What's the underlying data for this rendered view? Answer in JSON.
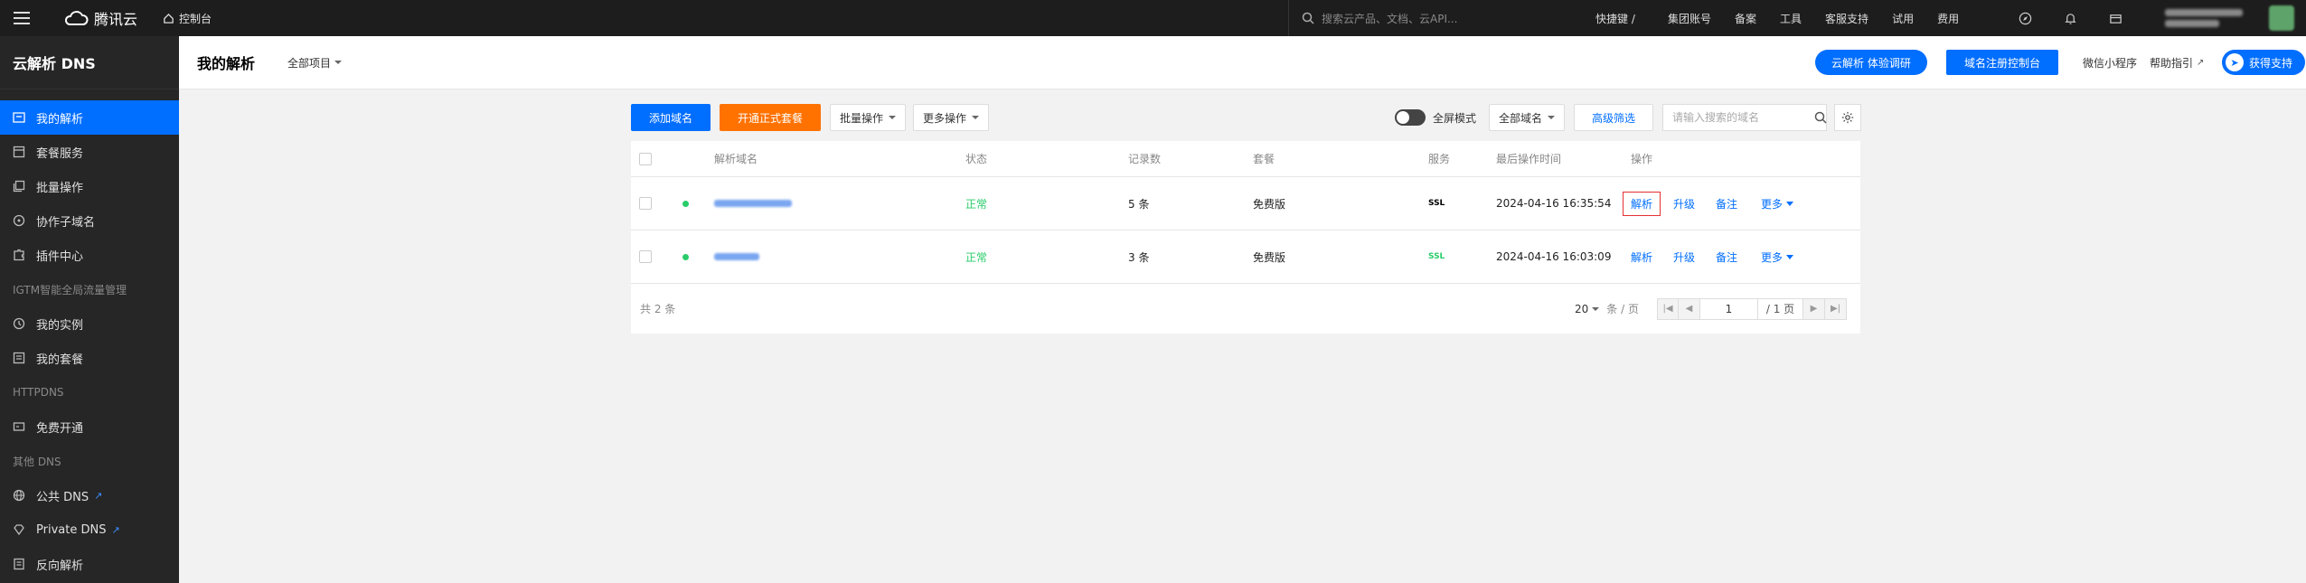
{
  "topbar": {
    "brand": "腾讯云",
    "console": "控制台",
    "search_placeholder": "搜索云产品、文档、云API...",
    "shortcut": "快捷键 /",
    "nav": [
      "集团账号",
      "备案",
      "工具",
      "客服支持",
      "试用",
      "费用"
    ]
  },
  "sidebar": {
    "title": "云解析 DNS",
    "items": [
      {
        "label": "我的解析",
        "icon": "dns-icon",
        "active": true
      },
      {
        "label": "套餐服务",
        "icon": "package-icon"
      },
      {
        "label": "批量操作",
        "icon": "batch-icon"
      },
      {
        "label": "协作子域名",
        "icon": "share-icon"
      },
      {
        "label": "插件中心",
        "icon": "plugin-icon"
      }
    ],
    "section_igtm": "IGTM智能全局流量管理",
    "igtm_items": [
      {
        "label": "我的实例",
        "icon": "instance-icon"
      },
      {
        "label": "我的套餐",
        "icon": "list-icon"
      }
    ],
    "section_httpdns": "HTTPDNS",
    "httpdns_items": [
      {
        "label": "免费开通",
        "icon": "card-icon"
      }
    ],
    "section_other": "其他 DNS",
    "other_items": [
      {
        "label": "公共 DNS",
        "icon": "globe-icon"
      },
      {
        "label": "Private DNS",
        "icon": "diamond-icon"
      },
      {
        "label": "反向解析",
        "icon": "doc-icon"
      }
    ]
  },
  "header": {
    "title": "我的解析",
    "project": "全部项目",
    "survey_button": "云解析 体验调研",
    "registrar_button": "域名注册控制台",
    "mini_program": "微信小程序",
    "help": "帮助指引",
    "support": "获得支持"
  },
  "toolbar": {
    "add_domain": "添加域名",
    "open_package": "开通正式套餐",
    "batch_ops": "批量操作",
    "more_ops": "更多操作",
    "fullscreen": "全屏模式",
    "all_domains": "全部域名",
    "advanced_filter": "高级筛选",
    "search_placeholder": "请输入搜索的域名"
  },
  "table": {
    "columns": [
      "解析域名",
      "状态",
      "记录数",
      "套餐",
      "服务",
      "最后操作时间",
      "操作"
    ],
    "rows": [
      {
        "status": "正常",
        "records": "5 条",
        "plan": "免费版",
        "service": "SSL",
        "time": "2024-04-16 16:35:54",
        "actions": [
          "解析",
          "升级",
          "备注",
          "更多"
        ]
      },
      {
        "status": "正常",
        "records": "3 条",
        "plan": "免费版",
        "service": "SSL",
        "time": "2024-04-16 16:03:09",
        "actions": [
          "解析",
          "升级",
          "备注",
          "更多"
        ]
      }
    ],
    "total": "共 2 条",
    "page_size": "20",
    "per_page": "条 / 页",
    "page": "1",
    "page_total": "/ 1 页"
  },
  "colors": {
    "primary": "#006eff",
    "orange": "#ff7200",
    "success": "#29cc6a",
    "sidebar_bg": "#262626",
    "topbar_bg": "#1d1d1d"
  }
}
